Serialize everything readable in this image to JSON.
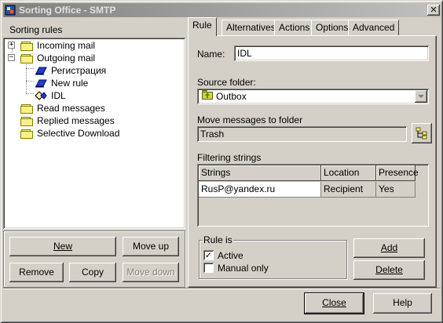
{
  "window": {
    "title": "Sorting Office - SMTP",
    "close_glyph": "✕"
  },
  "left": {
    "section_label": "Sorting rules",
    "tree": [
      {
        "label": "Incoming mail",
        "kind": "folder",
        "expander": "+"
      },
      {
        "label": "Outgoing mail",
        "kind": "folder",
        "expander": "−"
      },
      {
        "label": "Регистрация",
        "kind": "rule"
      },
      {
        "label": "New rule",
        "kind": "rule"
      },
      {
        "label": "IDL",
        "kind": "rule-selected"
      },
      {
        "label": "Read messages",
        "kind": "folder"
      },
      {
        "label": "Replied messages",
        "kind": "folder"
      },
      {
        "label": "Selective Download",
        "kind": "folder"
      }
    ],
    "buttons": {
      "new": "New",
      "move_up": "Move up",
      "remove": "Remove",
      "copy": "Copy",
      "move_down": "Move down"
    }
  },
  "tabs": [
    "Rule",
    "Alternatives",
    "Actions",
    "Options",
    "Advanced"
  ],
  "rule": {
    "name_label": "Name:",
    "name_value": "IDL",
    "source_label": "Source folder:",
    "source_value": "Outbox",
    "move_label": "Move messages to folder",
    "move_value": "Trash",
    "filter_label": "Filtering strings",
    "grid_headers": [
      "Strings",
      "Location",
      "Presence"
    ],
    "grid_rows": [
      [
        "RusP@yandex.ru",
        "Recipient",
        "Yes"
      ]
    ],
    "rule_is_label": "Rule is",
    "active_label": "Active",
    "active_checked": true,
    "manual_label": "Manual only",
    "manual_checked": false,
    "add_button": "Add",
    "delete_button": "Delete"
  },
  "footer": {
    "close": "Close",
    "help": "Help"
  },
  "icons": {
    "app": "sorting-office-icon",
    "folder": "folder-icon",
    "rule": "rule-icon",
    "browse": "browse-folder-icon",
    "dropdown": "chevron-down-icon"
  }
}
